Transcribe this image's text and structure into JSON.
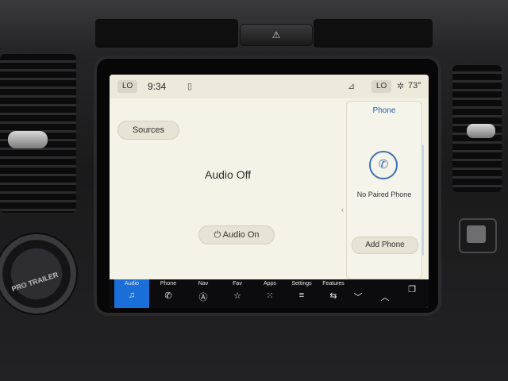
{
  "status": {
    "lo_left": "LO",
    "time": "9:34",
    "phone_icon": "phone-outline-icon",
    "signal_icon": "no-signal-icon",
    "lo_right": "LO",
    "fan_icon": "fan-icon",
    "temperature": "73°"
  },
  "main": {
    "sources_label": "Sources",
    "audio_off_label": "Audio Off",
    "audio_on_label": "Audio On",
    "audio_on_icon": "power-icon"
  },
  "phone": {
    "title": "Phone",
    "status": "No Paired Phone",
    "add_label": "Add Phone"
  },
  "nav": {
    "items": [
      {
        "label": "Audio",
        "icon": "♫",
        "active": true
      },
      {
        "label": "Phone",
        "icon": "✆"
      },
      {
        "label": "Nav",
        "icon": "Ⓐ"
      },
      {
        "label": "Fav",
        "icon": "☆"
      },
      {
        "label": "Apps",
        "icon": "⁙"
      },
      {
        "label": "Settings",
        "icon": "≡"
      },
      {
        "label": "Features",
        "icon": "⇆"
      },
      {
        "label": "",
        "icon": "﹀"
      },
      {
        "label": "",
        "icon": "︿"
      },
      {
        "label": "",
        "icon": "❐"
      }
    ]
  },
  "dash": {
    "pro_trailer": "PRO TRAILER"
  },
  "colors": {
    "accent": "#1a6ed8",
    "screen_bg": "#f2f1e4",
    "phone_blue": "#3c6fb8"
  }
}
